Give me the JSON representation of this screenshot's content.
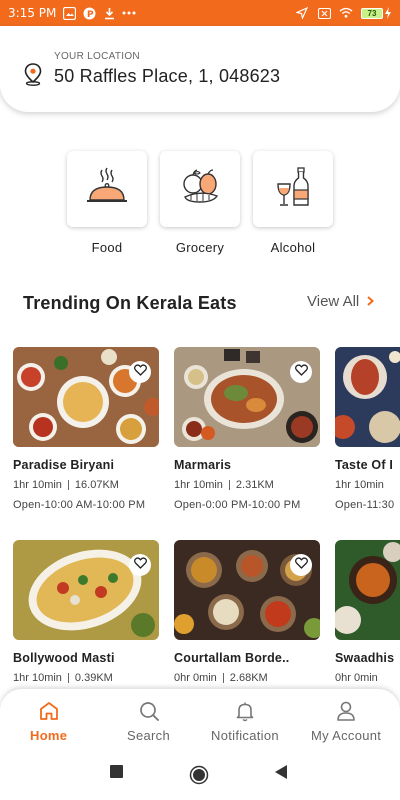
{
  "status_bar": {
    "time": "3:15 PM",
    "left_icons": [
      "photo-icon",
      "p-app-icon",
      "download-icon",
      "more-dots-icon"
    ],
    "battery_level": "73"
  },
  "location": {
    "label": "YOUR LOCATION",
    "address": "50 Raffles Place, 1, 048623"
  },
  "categories": [
    {
      "label": "Food",
      "icon": "cloche-icon"
    },
    {
      "label": "Grocery",
      "icon": "groceries-icon"
    },
    {
      "label": "Alcohol",
      "icon": "bottle-glass-icon"
    }
  ],
  "trending": {
    "title": "Trending On Kerala Eats",
    "view_all": "View All"
  },
  "restaurants": [
    {
      "name": "Paradise Biryani",
      "time": "1hr 10min",
      "distance": "16.07KM",
      "hours": "Open-10:00 AM-10:00 PM"
    },
    {
      "name": "Marmaris",
      "time": "1hr 10min",
      "distance": "2.31KM",
      "hours": "Open-0:00 PM-10:00 PM"
    },
    {
      "name": "Taste Of I",
      "time": "1hr 10min",
      "distance": "",
      "hours": "Open-11:30"
    },
    {
      "name": "Bollywood Masti",
      "time": "1hr 10min",
      "distance": "0.39KM",
      "hours": ""
    },
    {
      "name": "Courtallam Borde..",
      "time": "0hr 0min",
      "distance": "2.68KM",
      "hours": ""
    },
    {
      "name": "Swaadhis",
      "time": "0hr 0min",
      "distance": "",
      "hours": ""
    }
  ],
  "bottom_nav": [
    {
      "label": "Home",
      "icon": "home-icon",
      "active": true
    },
    {
      "label": "Search",
      "icon": "search-icon",
      "active": false
    },
    {
      "label": "Notification",
      "icon": "bell-icon",
      "active": false
    },
    {
      "label": "My Account",
      "icon": "user-icon",
      "active": false
    }
  ],
  "colors": {
    "accent": "#f26b1d",
    "text": "#222222",
    "muted": "#666666"
  }
}
